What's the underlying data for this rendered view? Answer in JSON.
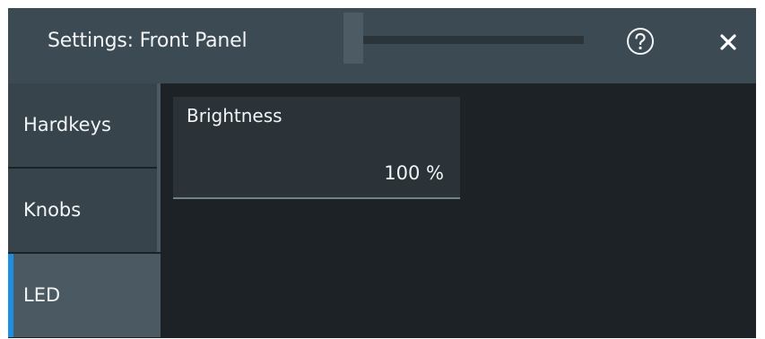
{
  "dialog": {
    "title": "Settings: Front Panel"
  },
  "icons": {
    "help": "help-icon",
    "close": "close-icon"
  },
  "nav": {
    "items": [
      {
        "label": "Hardkeys",
        "active": false
      },
      {
        "label": "Knobs",
        "active": false
      },
      {
        "label": "LED",
        "active": true
      }
    ]
  },
  "content": {
    "brightness": {
      "label": "Brightness",
      "value": "100 %"
    }
  },
  "colors": {
    "accent": "#1e8fe0",
    "background": "#1c2226",
    "titlebar": "#3c4a54",
    "text": "#f2f4f5"
  }
}
